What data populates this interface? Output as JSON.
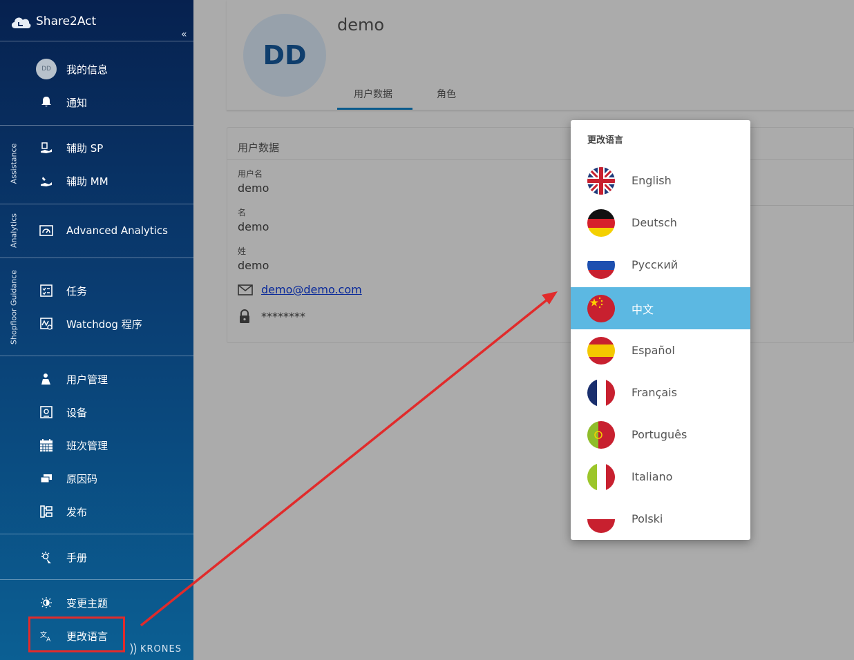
{
  "app": {
    "title": "Share2Act",
    "collapse_icon": "«"
  },
  "sidebar": {
    "profile": {
      "initials": "DD",
      "label": "我的信息"
    },
    "notifications": "通知",
    "sections": {
      "assistance": "Assistance",
      "analytics": "Analytics",
      "shopfloor": "Shopfloor Guidance"
    },
    "assist_sp": "辅助 SP",
    "assist_mm": "辅助 MM",
    "advanced_analytics": "Advanced Analytics",
    "tasks": "任务",
    "watchdog": "Watchdog 程序",
    "user_mgmt": "用户管理",
    "devices": "设备",
    "shift_mgmt": "班次管理",
    "reason_codes": "原因码",
    "publish": "发布",
    "manual": "手册",
    "change_theme": "变更主题",
    "change_language": "更改语言",
    "brand": "KRONES"
  },
  "profile_header": {
    "initials": "DD",
    "username": "demo",
    "tabs": [
      "用户数据",
      "角色"
    ],
    "active_tab": 0
  },
  "user_data": {
    "title": "用户数据",
    "fields": [
      {
        "label": "用户名",
        "value": "demo"
      },
      {
        "label": "名",
        "value": "demo"
      },
      {
        "label": "姓",
        "value": "demo"
      }
    ],
    "email": "demo@demo.com",
    "password": "********"
  },
  "language_menu": {
    "title": "更改语言",
    "active": "中文",
    "items": [
      "English",
      "Deutsch",
      "Русский",
      "中文",
      "Español",
      "Français",
      "Português",
      "Italiano",
      "Polski"
    ]
  },
  "colors": {
    "highlight": "#e12b2b",
    "active_item": "#5cb8e2",
    "sidebar_top": "#06214f",
    "sidebar_bottom": "#0b5f93"
  }
}
